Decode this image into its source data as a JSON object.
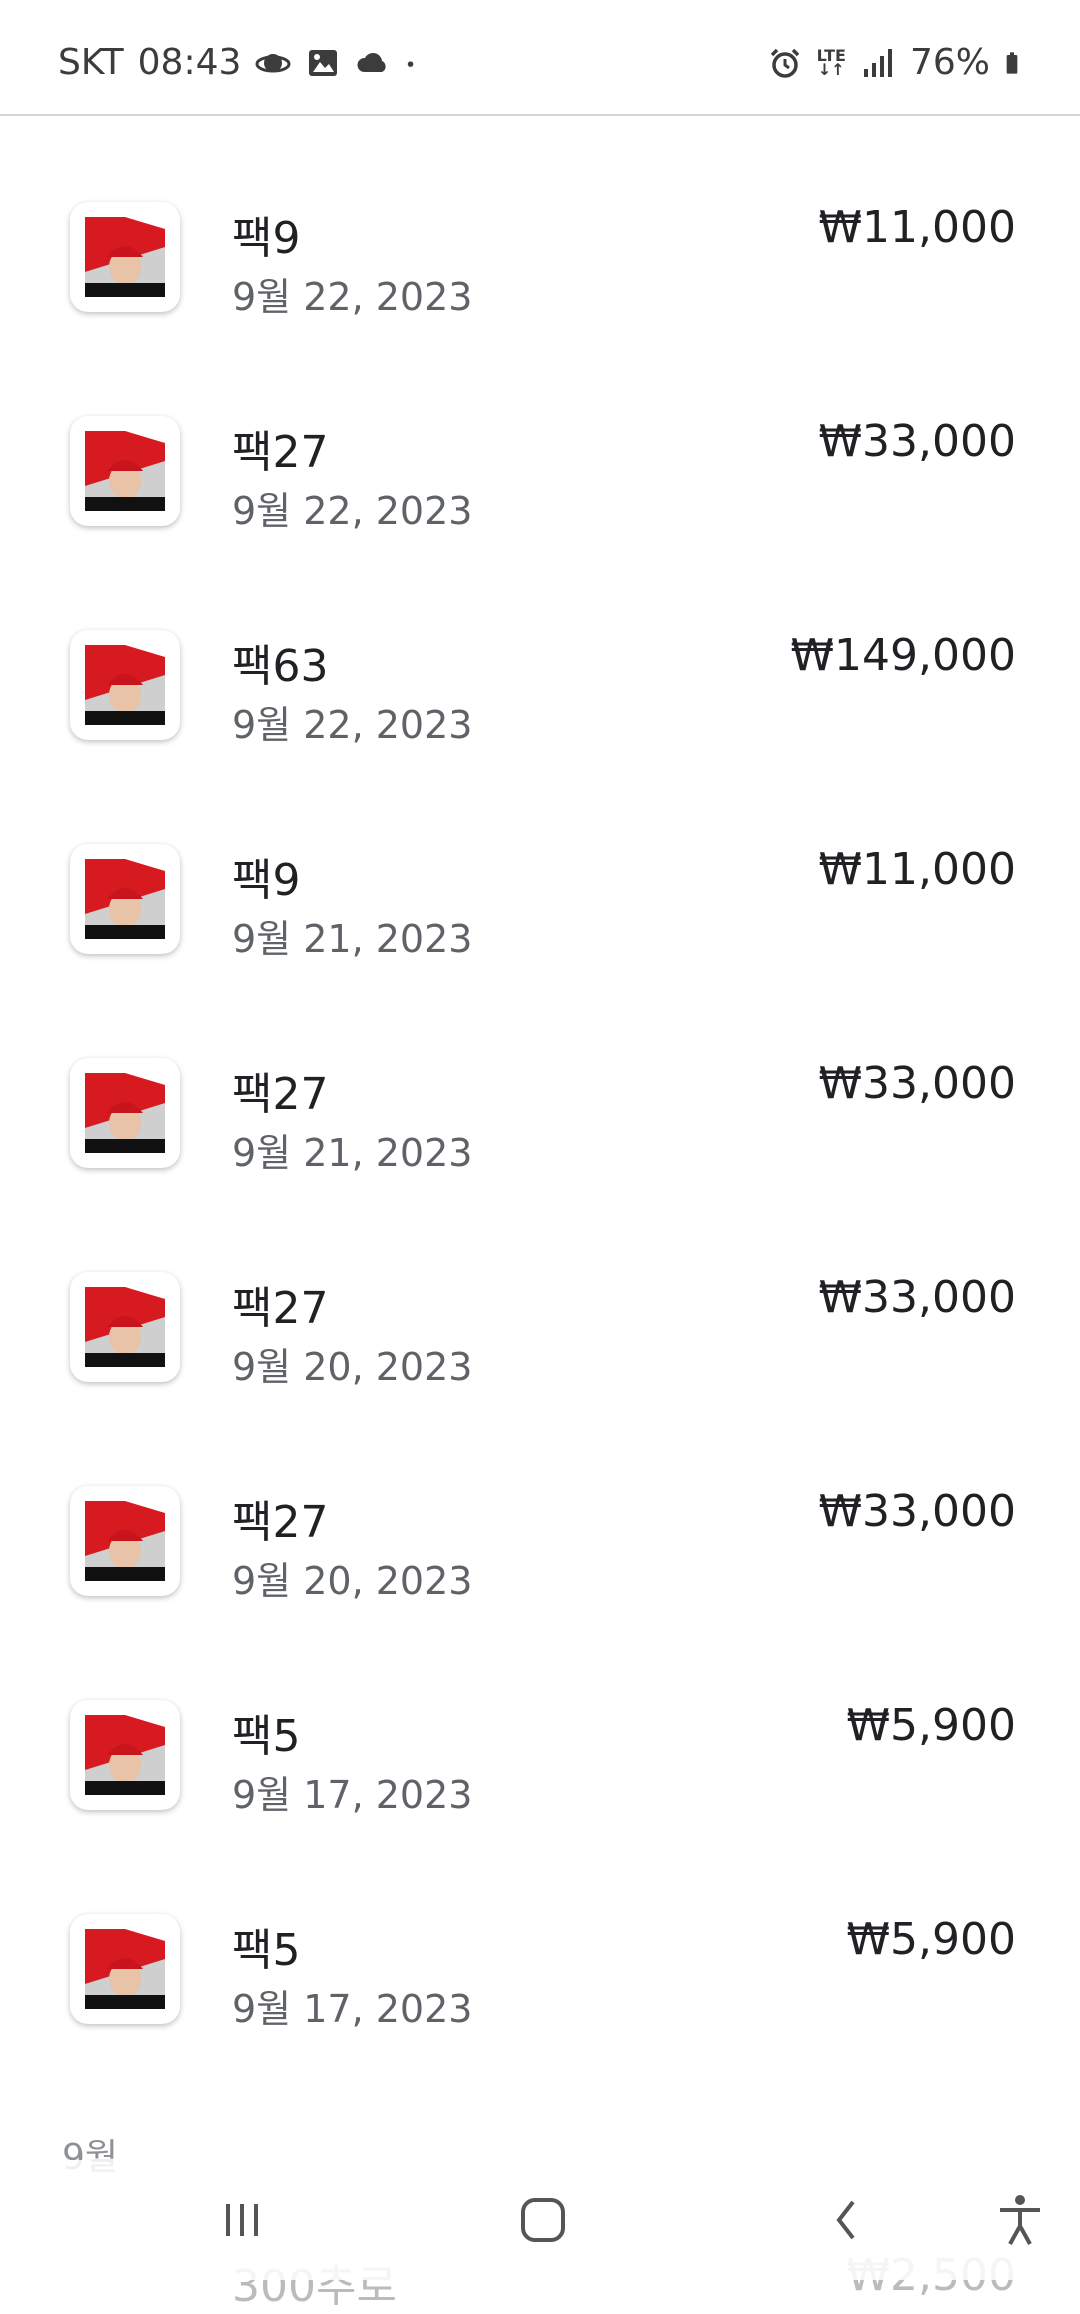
{
  "status_bar": {
    "carrier": "SKT",
    "time": "08:43",
    "network": "LTE",
    "battery": "76%",
    "left_icons": [
      "saturn-icon",
      "image-icon",
      "cloud-icon",
      "dot-icon"
    ],
    "right_icons": [
      "alarm-icon",
      "lte-data-icon",
      "signal-icon",
      "battery-icon"
    ]
  },
  "purchases": [
    {
      "name": "팩9",
      "date": "9월 22, 2023",
      "price": "₩11,000"
    },
    {
      "name": "팩27",
      "date": "9월 22, 2023",
      "price": "₩33,000"
    },
    {
      "name": "팩63",
      "date": "9월 22, 2023",
      "price": "₩149,000"
    },
    {
      "name": "팩9",
      "date": "9월 21, 2023",
      "price": "₩11,000"
    },
    {
      "name": "팩27",
      "date": "9월 21, 2023",
      "price": "₩33,000"
    },
    {
      "name": "팩27",
      "date": "9월 20, 2023",
      "price": "₩33,000"
    },
    {
      "name": "팩27",
      "date": "9월 20, 2023",
      "price": "₩33,000"
    },
    {
      "name": "팩5",
      "date": "9월 17, 2023",
      "price": "₩5,900"
    },
    {
      "name": "팩5",
      "date": "9월 17, 2023",
      "price": "₩5,900"
    }
  ],
  "next_section": {
    "month": "9월",
    "peek_name": "300추로",
    "peek_price": "₩2,500"
  },
  "navigation": {
    "buttons": [
      "recent-apps",
      "home",
      "back",
      "accessibility"
    ]
  },
  "colors": {
    "text_primary": "#202124",
    "text_secondary": "#5f6368",
    "app_icon_red": "#d71920"
  }
}
